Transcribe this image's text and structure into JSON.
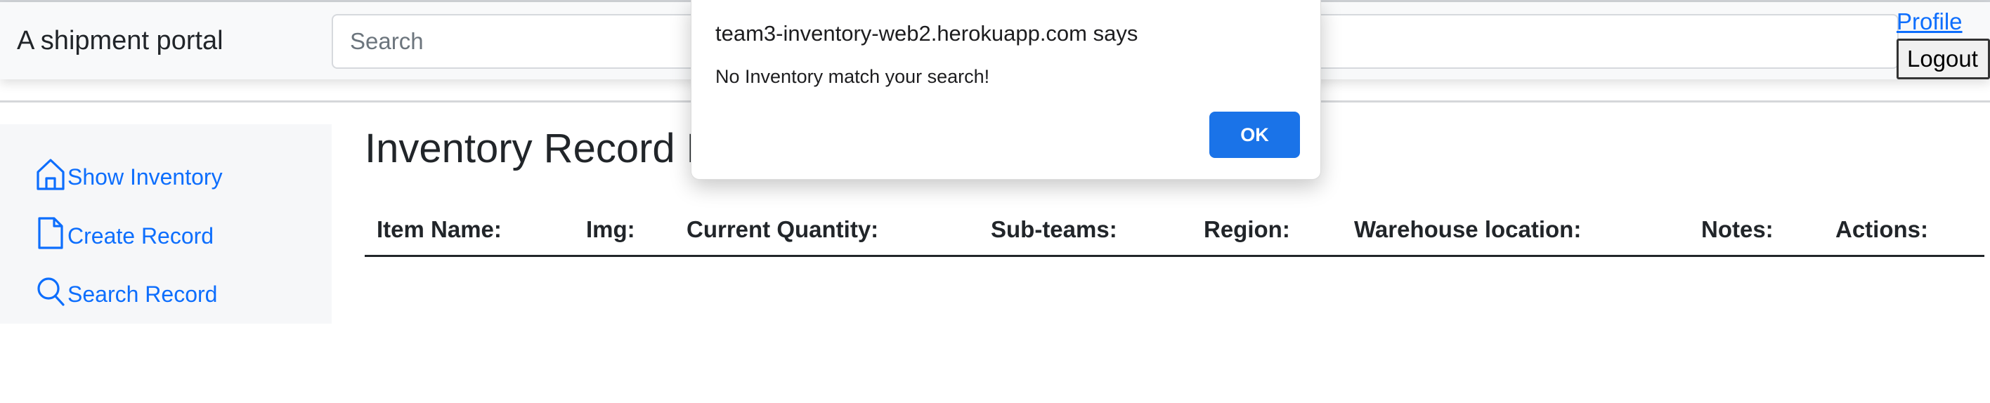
{
  "navbar": {
    "brand": "A shipment portal",
    "search_placeholder": "Search",
    "profile_label": "Profile",
    "logout_label": "Logout"
  },
  "sidebar": {
    "items": [
      {
        "label": "Show Inventory",
        "icon": "home-icon"
      },
      {
        "label": "Create Record",
        "icon": "file-icon"
      },
      {
        "label": "Search Record",
        "icon": "search-icon"
      }
    ]
  },
  "main": {
    "title": "Inventory Record List",
    "columns": [
      "Item Name:",
      "Img:",
      "Current Quantity:",
      "Sub-teams:",
      "Region:",
      "Warehouse location:",
      "Notes:",
      "Actions:"
    ]
  },
  "dialog": {
    "title": "team3-inventory-web2.herokuapp.com says",
    "message": "No Inventory match your search!",
    "ok_label": "OK"
  },
  "colors": {
    "link": "#0d6efd",
    "ok_button": "#1a73e8",
    "navbar_bg": "#f8f9fa"
  }
}
